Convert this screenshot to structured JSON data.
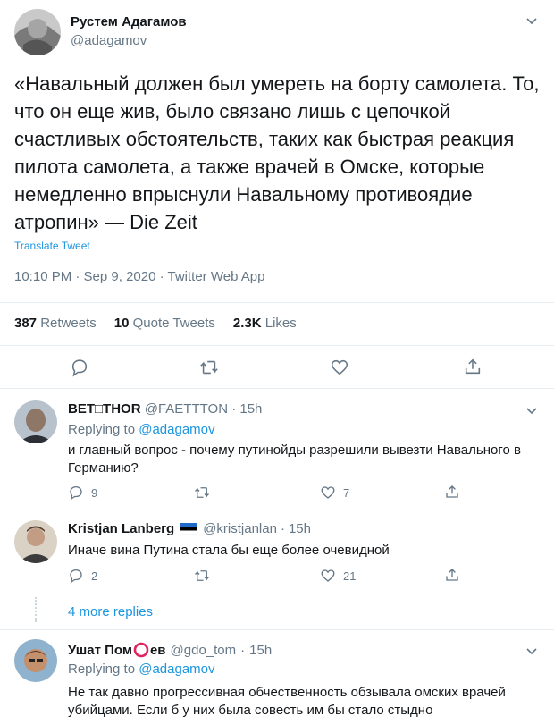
{
  "main_tweet": {
    "author_name": "Рустем Адагамов",
    "author_handle": "@adagamov",
    "text": "«Навальный должен был умереть на борту самолета. То, что он еще жив, было связано лишь с цепочкой счастливых обстоятельств, таких как быстрая реакция пилота самолета, а также врачей в Омске, которые немедленно впрыснули Навальному противоядие атропин» — Die Zeit",
    "translate_label": "Translate Tweet",
    "meta": "10:10 PM · Sep 9, 2020 · Twitter Web App",
    "stats": {
      "retweets_count": "387",
      "retweets_label": "Retweets",
      "quotes_count": "10",
      "quotes_label": "Quote Tweets",
      "likes_count": "2.3K",
      "likes_label": "Likes"
    }
  },
  "replies": [
    {
      "name": "BET□THOR",
      "handle": "@FAETTTON",
      "time": "15h",
      "replying_prefix": "Replying to",
      "replying_to": "@adagamov",
      "text": "и главный вопрос - почему  путинойды разрешили вывезти Навального в Германию?",
      "reply_count": "9",
      "retweet_count": "",
      "like_count": "7"
    },
    {
      "name": "Kristjan Lanberg",
      "handle": "@kristjanlan",
      "time": "15h",
      "text": "Иначе вина Путина стала бы еще более очевидной",
      "reply_count": "2",
      "retweet_count": "",
      "like_count": "21"
    },
    {
      "name_before": "Ушат Пом",
      "name_after": "ев",
      "handle": "@gdo_tom",
      "time": "15h",
      "replying_prefix": "Replying to",
      "replying_to": "@adagamov",
      "text": "Не так давно прогрессивная обчественность обзывала омских врачей убийцами. Если б у них была совесть им бы стало стыдно"
    }
  ],
  "more_replies_label": "4 more replies",
  "separator_dot": "·",
  "colors": {
    "link": "#1b95e0",
    "muted": "#657786",
    "divider": "#e6ecf0",
    "ring": "#e0245e"
  }
}
